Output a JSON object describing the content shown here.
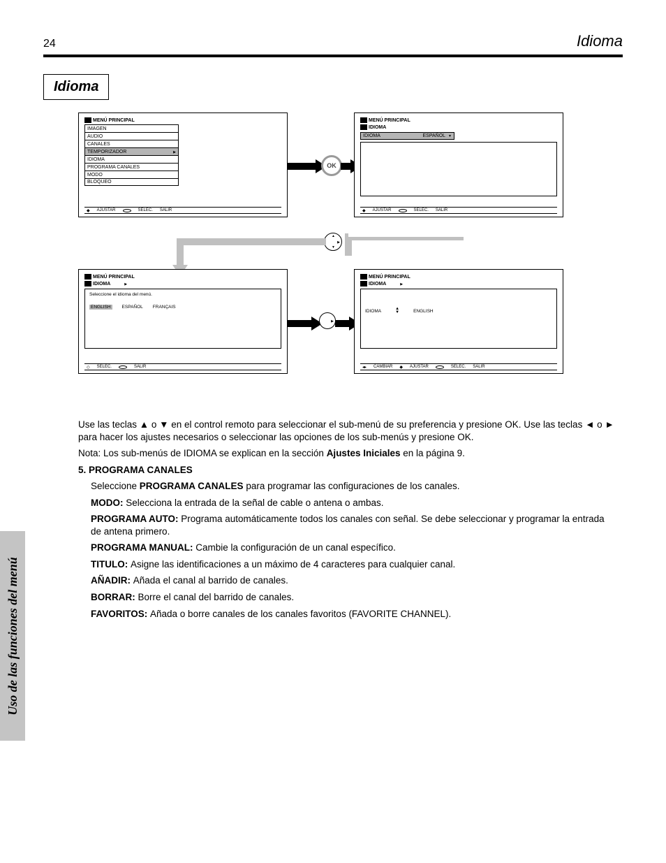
{
  "header": {
    "page_number": "24",
    "section_title": "Idioma"
  },
  "chapter": "Idioma",
  "side_tab": "Uso de las funciones del menú",
  "screens": {
    "tl": {
      "title": "MENÚ PRINCIPAL",
      "items": [
        "IMAGEN",
        "AUDIO",
        "CANALES",
        "TEMPORIZADOR",
        "IDIOMA",
        "PROGRAMA CANALES",
        "MODO",
        "BLOQUEO"
      ],
      "selected_index": 3,
      "footer": [
        "AJUSTAR",
        "SELEC.",
        "SALIR"
      ]
    },
    "tr": {
      "title": "MENÚ PRINCIPAL",
      "sub": "IDIOMA",
      "dropdown": {
        "label": "IDIOMA",
        "value": "ESPAÑOL"
      },
      "footer": [
        "AJUSTAR",
        "SELEC.",
        "SALIR"
      ]
    },
    "bl": {
      "title": "MENÚ PRINCIPAL",
      "sub": "IDIOMA",
      "question": "Seleccione el idioma del menú.",
      "options": [
        "ENGLISH",
        "ESPAÑOL",
        "FRANÇAIS"
      ],
      "selected_index": 0,
      "footer": [
        "SELEC.",
        "SALIR"
      ]
    },
    "br": {
      "title": "MENÚ PRINCIPAL",
      "sub": "IDIOMA",
      "row_label": "IDIOMA",
      "row_value": "ENGLISH",
      "footer": [
        "CAMBIAR",
        "AJUSTAR",
        "SELEC.",
        "SALIR"
      ]
    }
  },
  "ok_label": "OK",
  "body": {
    "intro": "Use las teclas ▲ o ▼ en el control remoto para seleccionar el sub-menú de su preferencia y presione OK. Use las teclas ◄ o ► para hacer los ajustes necesarios o seleccionar las opciones de los sub-menús y presione OK.",
    "note": "Nota: Los sub-menús de IDIOMA se explican en la sección ",
    "note_link": "Ajustes Iniciales",
    "note_tail": " en la página 9.",
    "step5_label": "5. PROGRAMA CANALES",
    "step5_select": "Seleccione ",
    "step5_term": "PROGRAMA CANALES",
    "step5_tail": " para programar las configuraciones de los canales.",
    "items": [
      {
        "head": "MODO:",
        "text": "Selecciona la entrada de la señal de cable o antena o ambas."
      },
      {
        "head": "PROGRAMA AUTO:",
        "text": "Programa automáticamente todos los canales con señal. Se debe seleccionar y programar la entrada de antena primero."
      },
      {
        "head": "PROGRAMA MANUAL:",
        "text": "Cambie la configuración de un canal específico."
      },
      {
        "head": "TITULO:",
        "text": "Asigne las identificaciones a un máximo de 4 caracteres para cualquier canal."
      },
      {
        "head": "AÑADIR:",
        "text": "Añada el canal al barrido de canales."
      },
      {
        "head": "BORRAR:",
        "text": "Borre el canal del barrido de canales."
      },
      {
        "head": "FAVORITOS:",
        "text": "Añada o borre canales de los canales favoritos (FAVORITE CHANNEL)."
      }
    ]
  }
}
